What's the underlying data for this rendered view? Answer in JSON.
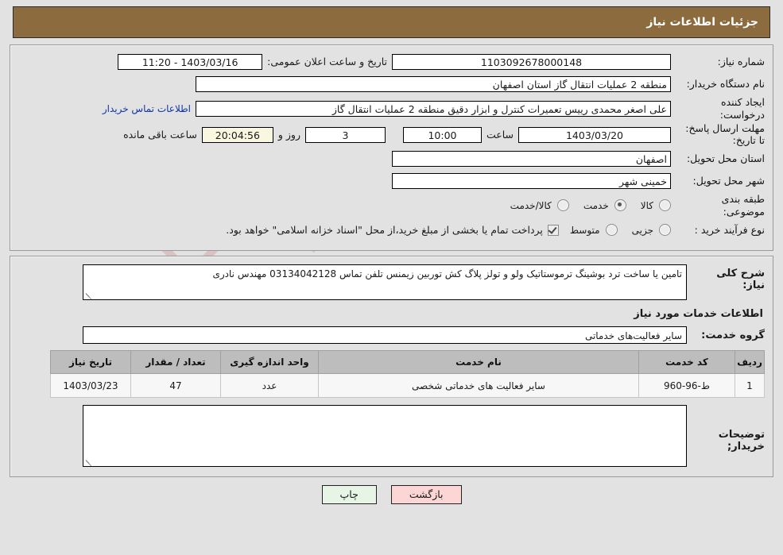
{
  "header": {
    "title": "جزئیات اطلاعات نیاز",
    "bar_color": "#8c6b3f"
  },
  "watermark": {
    "text": "AriaTender.net"
  },
  "info": {
    "need_number_label": "شماره نیاز:",
    "need_number_value": "1103092678000148",
    "publish_datetime_label": "تاریخ و ساعت اعلان عمومی:",
    "publish_datetime_value": "1403/03/16 - 11:20",
    "buyer_org_label": "نام دستگاه خریدار:",
    "buyer_org_value": "منطقه 2 عملیات انتقال گاز استان اصفهان",
    "creator_label": "ایجاد کننده درخواست:",
    "creator_value": "علی اصغر محمدی رییس تعمیرات کنترل و ابزار دقیق منطقه 2 عملیات انتقال گاز",
    "buyer_contact_link": "اطلاعات تماس خریدار",
    "deadline_label": "مهلت ارسال پاسخ: تا تاریخ:",
    "deadline_date": "1403/03/20",
    "hour_label": "ساعت",
    "hour_value": "10:00",
    "days_value": "3",
    "days_sep_label": "روز و",
    "countdown_value": "20:04:56",
    "remaining_label": "ساعت باقی مانده",
    "province_label": "استان محل تحویل:",
    "province_value": "اصفهان",
    "city_label": "شهر محل تحویل:",
    "city_value": "خمینی شهر",
    "category_label": "طبقه بندی موضوعی:",
    "category_options": [
      {
        "label": "کالا",
        "selected": false
      },
      {
        "label": "خدمت",
        "selected": true
      },
      {
        "label": "کالا/خدمت",
        "selected": false
      }
    ],
    "process_label": "نوع فرآیند خرید :",
    "process_options": [
      {
        "label": "جزیی",
        "selected": false
      },
      {
        "label": "متوسط",
        "selected": false
      }
    ],
    "treasury_checkbox_checked": true,
    "treasury_note": "پرداخت تمام یا بخشی از مبلغ خرید،از محل \"اسناد خزانه اسلامی\" خواهد بود."
  },
  "need_description": {
    "label": "شرح کلی نیاز:",
    "value": "تامین یا ساخت ترد بوشینگ ترموستاتیک ولو  و تولز پلاگ کش توربین زیمنس تلفن تماس 03134042128 مهندس نادری"
  },
  "services_section": {
    "title": "اطلاعات خدمات مورد نیاز",
    "group_label": "گروه خدمت:",
    "group_value": "سایر فعالیت‌های خدماتی",
    "columns": [
      "ردیف",
      "کد خدمت",
      "نام خدمت",
      "واحد اندازه گیری",
      "تعداد / مقدار",
      "تاریخ نیاز"
    ],
    "rows": [
      {
        "radif": "1",
        "code": "ط-96-960",
        "name": "سایر فعالیت های خدماتی شخصی",
        "unit": "عدد",
        "quantity": "47",
        "date": "1403/03/23"
      }
    ]
  },
  "buyer_notes": {
    "label": "توضیحات خریدار;",
    "value": ""
  },
  "buttons": {
    "back": "بازگشت",
    "print": "چاپ"
  }
}
